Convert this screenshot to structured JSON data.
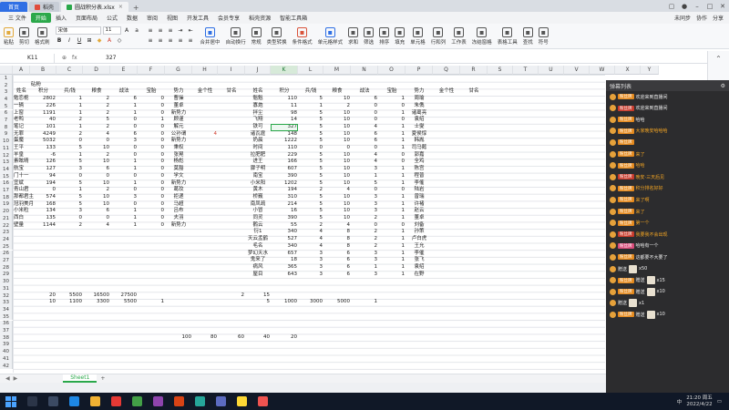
{
  "titlebar": {
    "tabs": [
      {
        "label": "首页",
        "kind": "home"
      },
      {
        "label": "稻壳",
        "kind": "normal",
        "color": "#e04b3a"
      },
      {
        "label": "圆战积分表.xlsx",
        "kind": "active",
        "color": "#2aa84a"
      }
    ]
  },
  "menubar": {
    "items": [
      "三 文件",
      "开始",
      "插入",
      "页面布局",
      "公式",
      "数据",
      "审阅",
      "视图",
      "开发工具",
      "会员专享",
      "稻壳资源",
      "智能工具箱"
    ],
    "selected_index": 1,
    "right": [
      "未同步",
      "协作",
      "分享"
    ]
  },
  "ribbon": {
    "font_name": "宋体",
    "font_size": "11",
    "groups_left": [
      {
        "label": "粘贴",
        "icon": "paste-icon",
        "color": "#e2a93b"
      },
      {
        "label": "剪切",
        "icon": "cut-icon",
        "color": "#555555"
      },
      {
        "label": "格式刷",
        "icon": "brush-icon",
        "color": "#555555"
      }
    ],
    "groups_right": [
      {
        "label": "合并居中",
        "icon": "merge-icon",
        "color": "#2f6fe4"
      },
      {
        "label": "自动换行",
        "icon": "wrap-icon",
        "color": "#555555"
      },
      {
        "label": "常规",
        "icon": "format-icon",
        "color": "#555555"
      },
      {
        "label": "类型转换",
        "icon": "convert-icon",
        "color": "#555555"
      },
      {
        "label": "条件格式",
        "icon": "condition-icon",
        "color": "#d9533a"
      },
      {
        "label": "单元格样式",
        "icon": "style-icon",
        "color": "#2f6fe4"
      },
      {
        "label": "求和",
        "icon": "sum-icon",
        "color": "#555555"
      },
      {
        "label": "筛选",
        "icon": "filter-icon",
        "color": "#555555"
      },
      {
        "label": "排序",
        "icon": "sort-icon",
        "color": "#555555"
      },
      {
        "label": "填充",
        "icon": "fill-icon",
        "color": "#555555"
      },
      {
        "label": "单元格",
        "icon": "cell-icon",
        "color": "#555555"
      },
      {
        "label": "行和列",
        "icon": "rowcol-icon",
        "color": "#555555"
      },
      {
        "label": "工作表",
        "icon": "sheet-icon",
        "color": "#555555"
      },
      {
        "label": "冻结窗格",
        "icon": "freeze-icon",
        "color": "#555555"
      },
      {
        "label": "表格工具",
        "icon": "tool-icon",
        "color": "#555555"
      },
      {
        "label": "查找",
        "icon": "find-icon",
        "color": "#555555"
      },
      {
        "label": "符号",
        "icon": "symbol-icon",
        "color": "#555555"
      }
    ]
  },
  "formulabar": {
    "cell_ref": "K11",
    "value": "327"
  },
  "columns": [
    "A",
    "B",
    "C",
    "D",
    "E",
    "F",
    "G",
    "H",
    "I",
    "J",
    "K",
    "L",
    "M",
    "N",
    "O",
    "P",
    "Q",
    "R",
    "S",
    "T",
    "U",
    "V",
    "W",
    "X",
    "Y"
  ],
  "selected_column": "K",
  "sheet": {
    "title": "砧粉",
    "headers_left": [
      "姓名",
      "积分",
      "兵/钱",
      "粮食",
      "战法",
      "宝胎",
      "势力",
      "金个性",
      "甘名"
    ],
    "headers_right": [
      "姓名",
      "积分",
      "兵/钱",
      "粮食",
      "战法",
      "宝胎",
      "势力",
      "金个性",
      "甘名"
    ],
    "left_rows": [
      [
        "勉恋栀",
        "2802",
        "1",
        "2",
        "6",
        "0",
        "曹操"
      ],
      [
        "一辆",
        "226",
        "1",
        "2",
        "1",
        "0",
        "董卓"
      ],
      [
        "上窗",
        "1191",
        "1",
        "2",
        "1",
        "0",
        "新势力"
      ],
      [
        "老鸭",
        "40",
        "2",
        "5",
        "0",
        "1",
        "顾谨"
      ],
      [
        "笔记",
        "101",
        "1",
        "2",
        "0",
        "0",
        "解元"
      ],
      [
        "无罪",
        "4249",
        "2",
        "4",
        "6",
        "0",
        "公孙谓"
      ],
      [
        "蛋魔",
        "5032",
        "0",
        "0",
        "3",
        "0",
        "新势力"
      ],
      [
        "王平",
        "133",
        "5",
        "10",
        "0",
        "0",
        "秉权"
      ],
      [
        "羊皇",
        "-6",
        "1",
        "2",
        "0",
        "0",
        "张晃"
      ],
      [
        "素眩晴",
        "126",
        "5",
        "10",
        "1",
        "0",
        "杨彪"
      ],
      [
        "航宝",
        "127",
        "3",
        "6",
        "1",
        "0",
        "莫豁"
      ],
      [
        "门十一",
        "94",
        "0",
        "0",
        "0",
        "0",
        "学文"
      ],
      [
        "宜斌",
        "194",
        "5",
        "10",
        "1",
        "0",
        "新势力"
      ],
      [
        "青山君",
        "0",
        "1",
        "2",
        "0",
        "0",
        "葛玟"
      ],
      [
        "那都君主",
        "574",
        "5",
        "10",
        "3",
        "0",
        "拒递"
      ],
      [
        "冠羽美月",
        "168",
        "5",
        "10",
        "0",
        "0",
        "马超"
      ],
      [
        "小米粒",
        "134",
        "3",
        "6",
        "1",
        "0",
        "吕布"
      ],
      [
        "西白",
        "135",
        "0",
        "0",
        "1",
        "0",
        "夫羽"
      ],
      [
        "壁量",
        "1144",
        "2",
        "4",
        "1",
        "0",
        "新势力"
      ]
    ],
    "left_extra_H": "4",
    "right_rows": [
      [
        "魁魁",
        "110",
        "5",
        "10",
        "6",
        "1",
        "周瑜"
      ],
      [
        "寡炮",
        "11",
        "1",
        "2",
        "0",
        "0",
        "朱儁"
      ],
      [
        "拌尘",
        "98",
        "5",
        "10",
        "0",
        "1",
        "诸葛亮"
      ],
      [
        "飞翔",
        "14",
        "5",
        "10",
        "0",
        "0",
        "袁绍"
      ],
      [
        "铁可",
        "327",
        "5",
        "10",
        "4",
        "1",
        "士燮"
      ],
      [
        "诸瓦霆",
        "148",
        "5",
        "10",
        "6",
        "1",
        "夏侯惇"
      ],
      [
        "奶晨",
        "1222",
        "5",
        "10",
        "6",
        "1",
        "韩胤"
      ],
      [
        "时间",
        "110",
        "0",
        "0",
        "0",
        "1",
        "司马懿"
      ],
      [
        "拉肥肥",
        "229",
        "5",
        "10",
        "4",
        "0",
        "郭嘉"
      ],
      [
        "进王",
        "166",
        "5",
        "10",
        "4",
        "0",
        "全鸡"
      ],
      [
        "骤子明",
        "607",
        "5",
        "10",
        "3",
        "1",
        "陈宫"
      ],
      [
        "南宝",
        "390",
        "5",
        "10",
        "1",
        "1",
        "程普"
      ],
      [
        "小米阳",
        "1202",
        "5",
        "10",
        "5",
        "1",
        "李傕"
      ],
      [
        "黄木",
        "194",
        "2",
        "4",
        "0",
        "0",
        "陆岩"
      ],
      [
        "桥巍",
        "310",
        "5",
        "10",
        "3",
        "1",
        "曾瑞"
      ],
      [
        "南凤疏",
        "214",
        "5",
        "10",
        "3",
        "1",
        "许褚"
      ],
      [
        "小冒",
        "16",
        "5",
        "10",
        "3",
        "1",
        "赵云"
      ],
      [
        "同灵",
        "390",
        "5",
        "10",
        "2",
        "1",
        "董卓"
      ],
      [
        "鹳云",
        "55",
        "2",
        "4",
        "0",
        "0",
        "刘备"
      ],
      [
        "衍1",
        "340",
        "4",
        "8",
        "2",
        "1",
        "孙策"
      ],
      [
        "天云孟鹤",
        "527",
        "4",
        "8",
        "2",
        "1",
        "卢白虎"
      ],
      [
        "毛名",
        "340",
        "4",
        "8",
        "2",
        "1",
        "王允"
      ],
      [
        "梦幻天水",
        "657",
        "3",
        "6",
        "3",
        "1",
        "李催"
      ],
      [
        "鬼来了",
        "18",
        "3",
        "6",
        "3",
        "1",
        "张飞"
      ],
      [
        "病风",
        "365",
        "3",
        "6",
        "1",
        "1",
        "袁绍"
      ],
      [
        "屋目",
        "643",
        "3",
        "6",
        "3",
        "1",
        "在野"
      ]
    ],
    "sum_row_32": {
      "B": "20",
      "C": "5500",
      "D": "16500",
      "E": "27500",
      "I": "2",
      "J": "15"
    },
    "sum_row_33": {
      "B": "10",
      "C": "1100",
      "D": "3300",
      "E": "5500",
      "F": "1",
      "J": "5",
      "K": "1000",
      "L": "3000",
      "M": "5000",
      "N": "1"
    },
    "row_38": {
      "G": "100",
      "H": "80",
      "I": "60",
      "J": "40",
      "K": "20"
    },
    "row_numbers": [
      "1",
      "2",
      "3",
      "4",
      "5",
      "6",
      "7",
      "8",
      "9",
      "10",
      "11",
      "12",
      "13",
      "14",
      "15",
      "16",
      "17",
      "18",
      "19",
      "20",
      "21",
      "22",
      "23",
      "24",
      "25",
      "26",
      "27",
      "28",
      "29",
      "30",
      "31",
      "32",
      "33",
      "34",
      "35",
      "36",
      "37",
      "38",
      "39",
      "40",
      "41",
      "42"
    ]
  },
  "sheet_tabs": {
    "active": "Sheet1",
    "add": "+"
  },
  "chat": {
    "header": "弹幕列表",
    "rows": [
      {
        "badge": "粉丝牌",
        "badge_color": "orange",
        "text": "欢迎来到直播间",
        "text_color": "white"
      },
      {
        "badge": "粉丝牌",
        "badge_color": "red",
        "text": "欢迎来到直播间",
        "text_color": "white"
      },
      {
        "badge": "粉丝牌",
        "badge_color": "orange",
        "text": "哈哈",
        "text_color": "white"
      },
      {
        "badge": "粉丝牌",
        "badge_color": "orange",
        "text": "大家晚安哈哈哈",
        "text_color": "orange"
      },
      {
        "badge": "粉丝牌",
        "badge_color": "orange",
        "text": "",
        "text_color": "white"
      },
      {
        "badge": "粉丝牌",
        "badge_color": "orange",
        "text": "来了",
        "text_color": "orange"
      },
      {
        "badge": "粉丝牌",
        "badge_color": "orange",
        "text": "哈哈",
        "text_color": "orange"
      },
      {
        "badge": "粉丝牌",
        "badge_color": "red",
        "text": "晚安·三天后见",
        "text_color": "orange"
      },
      {
        "badge": "粉丝牌",
        "badge_color": "orange",
        "text": "积分排名好好",
        "text_color": "orange"
      },
      {
        "badge": "粉丝牌",
        "badge_color": "orange",
        "text": "来了啊",
        "text_color": "orange"
      },
      {
        "badge": "粉丝牌",
        "badge_color": "orange",
        "text": "来了",
        "text_color": "orange"
      },
      {
        "badge": "粉丝牌",
        "badge_color": "orange",
        "text": "第一个",
        "text_color": "orange"
      },
      {
        "badge": "粉丝牌",
        "badge_color": "red",
        "text": "我要我不会出现",
        "text_color": "orange"
      },
      {
        "badge": "粉丝牌",
        "badge_color": "pink",
        "text": "哈哈有一个",
        "text_color": "white"
      },
      {
        "badge": "粉丝牌",
        "badge_color": "orange",
        "text": "这都要不大要了",
        "text_color": "white"
      },
      {
        "badge": "",
        "badge_color": "",
        "text": "赠送",
        "text_color": "white",
        "gift": "x50"
      },
      {
        "badge": "粉丝牌",
        "badge_color": "orange",
        "text": "赠送",
        "text_color": "white",
        "gift": "x15"
      },
      {
        "badge": "粉丝牌",
        "badge_color": "orange",
        "text": "赠送",
        "text_color": "white",
        "gift": "x10"
      },
      {
        "badge": "",
        "badge_color": "",
        "text": "赠送",
        "text_color": "white",
        "gift": "x1"
      },
      {
        "badge": "粉丝牌",
        "badge_color": "orange",
        "text": "赠送",
        "text_color": "white",
        "gift": "x10"
      }
    ]
  },
  "taskbar": {
    "time": "21:20 周五",
    "date": "2022/4/22",
    "lang": "中"
  }
}
